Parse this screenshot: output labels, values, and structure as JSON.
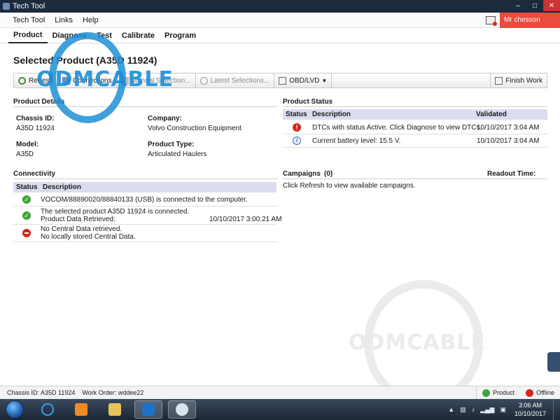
{
  "window": {
    "title": "Tech Tool"
  },
  "menu": {
    "items": [
      "Tech Tool",
      "Links",
      "Help"
    ],
    "user": "Mr chesson"
  },
  "nav": {
    "tabs": [
      "Product",
      "Diagnose",
      "Test",
      "Calibrate",
      "Program"
    ],
    "active": "Product"
  },
  "page": {
    "title": "Selected Product (A35D 11924)"
  },
  "toolbar": {
    "refresh": "Refresh",
    "connections": "Connections",
    "manual_selection": "Manual Selection...",
    "latest_selections": "Latest Selections...",
    "obd": "OBD/LVD",
    "finish_work": "Finish Work"
  },
  "product_details": {
    "title": "Product Details",
    "chassis_label": "Chassis ID:",
    "chassis_value": "A35D 11924",
    "company_label": "Company:",
    "company_value": "Volvo Construction Equipment",
    "model_label": "Model:",
    "model_value": "A35D",
    "type_label": "Product Type:",
    "type_value": "Articulated Haulers"
  },
  "product_status": {
    "title": "Product Status",
    "headers": [
      "Status",
      "Description",
      "Validated"
    ],
    "rows": [
      {
        "icon": "error-icon",
        "description": "DTCs with status Active. Click Diagnose to view DTCs.",
        "validated": "10/10/2017 3:04 AM"
      },
      {
        "icon": "info-icon",
        "description": "Current battery level: 15.5 V.",
        "validated": "10/10/2017 3:04 AM"
      }
    ]
  },
  "connectivity": {
    "title": "Connectivity",
    "headers": [
      "Status",
      "Description"
    ],
    "rows": [
      {
        "icon": "ok-icon",
        "line1": "VOCOM/88890020/88840133 (USB) is connected to the computer.",
        "line2": "",
        "time": ""
      },
      {
        "icon": "ok-icon",
        "line1": "The selected product A35D 11924 is connected.",
        "line2": "Product Data Retrieved:",
        "time": "10/10/2017 3:00:21 AM"
      },
      {
        "icon": "stop-icon",
        "line1": "No Central Data retrieved.",
        "line2": "No locally stored Central Data.",
        "time": ""
      }
    ]
  },
  "campaigns": {
    "title": "Campaigns",
    "count": "(0)",
    "readout_label": "Readout Time:",
    "message": "Click Refresh to view available campaigns."
  },
  "statusbar": {
    "chassis": "Chassis ID: A35D 11924",
    "work_order": "Work Order: wddee22",
    "product": "Product",
    "offline": "Offline"
  },
  "taskbar": {
    "time": "3:06 AM",
    "date": "10/10/2017"
  },
  "watermark": {
    "text_top": "ODMCABLE",
    "text_bottom": "ODMCABLE"
  },
  "colors": {
    "header_row": "#dcdcf0",
    "user_box": "#ea4b3c",
    "ok": "#3ea53a",
    "error": "#d8261c"
  }
}
